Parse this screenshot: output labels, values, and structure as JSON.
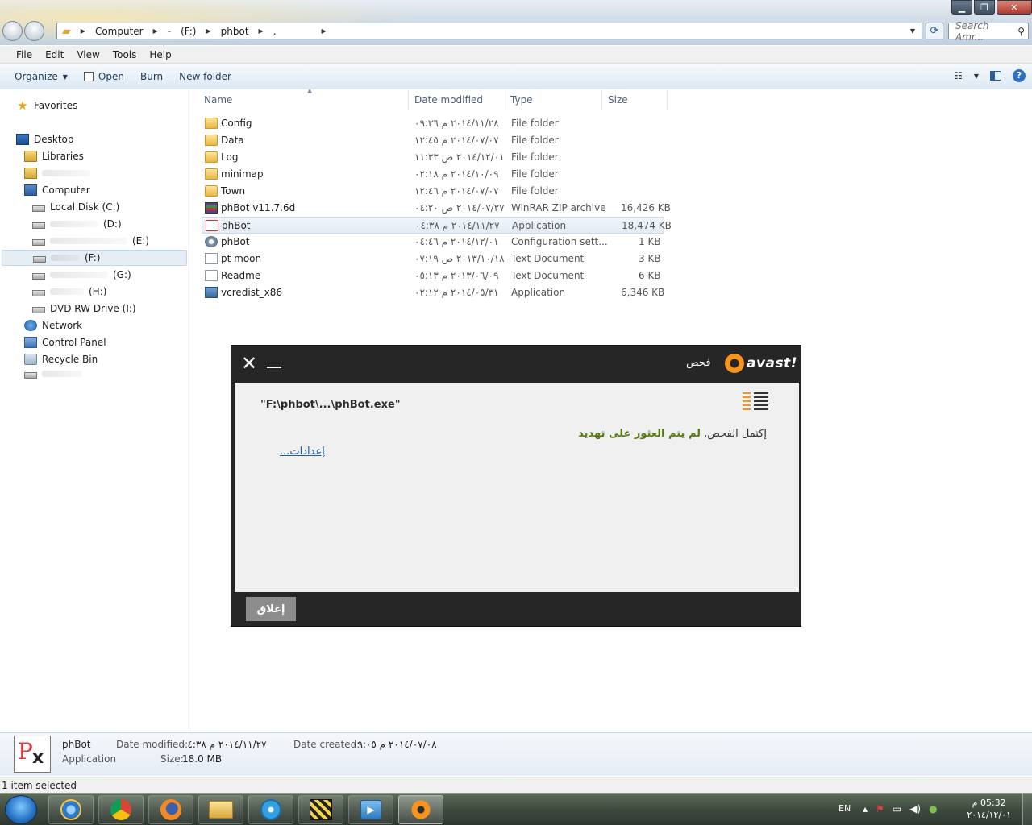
{
  "window": {
    "controls": {
      "minimize": "▁",
      "maximize": "❐",
      "close": "✕"
    }
  },
  "address": {
    "segments": [
      "Computer",
      "-",
      "(F:)",
      "phbot",
      "."
    ],
    "search_placeholder": "Search Amr..."
  },
  "menu": [
    "File",
    "Edit",
    "View",
    "Tools",
    "Help"
  ],
  "toolbar": {
    "organize": "Organize",
    "open": "Open",
    "burn": "Burn",
    "new_folder": "New folder"
  },
  "nav": {
    "favorites": "Favorites",
    "desktop": "Desktop",
    "libraries": "Libraries",
    "computer": "Computer",
    "local_disk": "Local Disk (C:)",
    "drive_d": "(D:)",
    "drive_e": "(E:)",
    "drive_f": "(F:)",
    "drive_g": "(G:)",
    "drive_h": "(H:)",
    "dvd": "DVD RW Drive (I:)",
    "network": "Network",
    "control_panel": "Control Panel",
    "recycle_bin": "Recycle Bin"
  },
  "columns": {
    "name": "Name",
    "date": "Date modified",
    "type": "Type",
    "size": "Size"
  },
  "files": [
    {
      "name": "Config",
      "date": "٢٠١٤/١١/٢٨ م ٠٩:٣٦",
      "type": "File folder",
      "size": "",
      "icon": "folder-icon"
    },
    {
      "name": "Data",
      "date": "٢٠١٤/٠٧/٠٧ م ١٢:٤٥",
      "type": "File folder",
      "size": "",
      "icon": "folder-icon"
    },
    {
      "name": "Log",
      "date": "٢٠١٤/١٢/٠١ ص ١١:٣٣",
      "type": "File folder",
      "size": "",
      "icon": "folder-icon"
    },
    {
      "name": "minimap",
      "date": "٢٠١٤/١٠/٠٩ م ٠٢:١٨",
      "type": "File folder",
      "size": "",
      "icon": "folder-icon"
    },
    {
      "name": "Town",
      "date": "٢٠١٤/٠٧/٠٧ م ١٢:٤٦",
      "type": "File folder",
      "size": "",
      "icon": "folder-icon"
    },
    {
      "name": "phBot v11.7.6d",
      "date": "٢٠١٤/٠٧/٢٧ ص ٠٤:٢٠",
      "type": "WinRAR ZIP archive",
      "size": "16,426 KB",
      "icon": "winrar-icon"
    },
    {
      "name": "phBot",
      "date": "٢٠١٤/١١/٢٧ م ٠٤:٣٨",
      "type": "Application",
      "size": "18,474 KB",
      "icon": "phbot-app-icon"
    },
    {
      "name": "phBot",
      "date": "٢٠١٤/١٢/٠١ م ٠٤:٤٦",
      "type": "Configuration sett...",
      "size": "1 KB",
      "icon": "config-icon"
    },
    {
      "name": "pt moon",
      "date": "٢٠١٣/١٠/١٨ ص ٠٧:١٩",
      "type": "Text Document",
      "size": "3 KB",
      "icon": "text-document-icon"
    },
    {
      "name": "Readme",
      "date": "٢٠١٣/٠٦/٠٩ م ٠٥:١٣",
      "type": "Text Document",
      "size": "6 KB",
      "icon": "text-document-icon"
    },
    {
      "name": "vcredist_x86",
      "date": "٢٠١٤/٠٥/٣١ م ٠٢:١٢",
      "type": "Application",
      "size": "6,346 KB",
      "icon": "setup-icon"
    }
  ],
  "avast": {
    "title": "فحص",
    "logo": "avast!",
    "path": "\"F:\\phbot\\...\\phBot.exe\"",
    "result_prefix": "إكتمل الفحص,",
    "result_bold": "لم يتم العثور على تهديد",
    "settings_link": "إعدادات...",
    "close_button": "إغلاق"
  },
  "details": {
    "name": "phBot",
    "kind": "Application",
    "date_modified_label": "Date modified:",
    "date_modified": "٢٠١٤/١١/٢٧ م ٠٤:٣٨",
    "size_label": "Size:",
    "size": "18.0 MB",
    "date_created_label": "Date created:",
    "date_created": "٢٠١٤/٠٧/٠٨ م ٠٩:٠٥"
  },
  "status": "1 item selected",
  "tray": {
    "lang": "EN",
    "time": "05:32 م",
    "date": "٢٠١٤/١٢/٠١"
  }
}
